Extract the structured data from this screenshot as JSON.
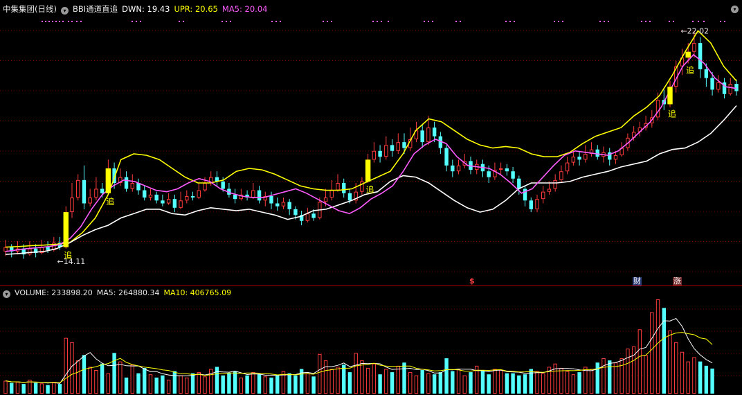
{
  "header": {
    "stock": "中集集团(日线)",
    "indicator": "BBI通道直追",
    "dwn_label": "DWN: 19.43",
    "upr_label": "UPR: 20.65",
    "ma5_label": "MA5: 20.04"
  },
  "volume_header": {
    "volume_label": "VOLUME: 233898.20",
    "ma5_label": "MA5: 264880.34",
    "ma10_label": "MA10: 406765.09"
  },
  "markers": {
    "low_label": "14.11",
    "high_label": "22.02",
    "zhui": "追",
    "event_s": "$",
    "event_cai": "财",
    "event_zhang": "涨"
  },
  "colors": {
    "up": "#ff3c3c",
    "down": "#54ffff",
    "upr_line": "#ffff00",
    "dwn_line": "#ffffff",
    "ma5_line": "#ff5cff",
    "zhui_bar": "#ffff00",
    "separator": "#b00000",
    "grid": "#7a0000"
  },
  "chart_data": {
    "type": "candlestick",
    "price_axis": {
      "low": 14.11,
      "high": 22.02
    },
    "candles_approx": [
      [
        14.45,
        14.6,
        14.85,
        14.3
      ],
      [
        14.6,
        14.45,
        14.7,
        14.25
      ],
      [
        14.45,
        14.55,
        14.8,
        14.35
      ],
      [
        14.55,
        14.35,
        14.7,
        14.2
      ],
      [
        14.35,
        14.55,
        14.8,
        14.3
      ],
      [
        14.55,
        14.4,
        14.7,
        14.25
      ],
      [
        14.4,
        14.6,
        14.85,
        14.35
      ],
      [
        14.6,
        14.5,
        14.8,
        14.4
      ],
      [
        14.5,
        14.75,
        14.95,
        14.45
      ],
      [
        14.75,
        14.6,
        14.95,
        14.5
      ],
      [
        14.6,
        15.8,
        16.0,
        14.55
      ],
      [
        15.8,
        16.3,
        16.8,
        15.6
      ],
      [
        16.3,
        16.9,
        17.1,
        16.2
      ],
      [
        16.9,
        16.1,
        17.4,
        15.9
      ],
      [
        16.1,
        16.3,
        16.6,
        16.0
      ],
      [
        16.3,
        16.6,
        17.0,
        16.2
      ],
      [
        16.6,
        16.45,
        16.8,
        16.3
      ],
      [
        16.45,
        17.3,
        17.6,
        16.4
      ],
      [
        17.3,
        16.8,
        17.5,
        16.6
      ],
      [
        16.8,
        17.0,
        17.3,
        16.7
      ],
      [
        17.0,
        16.6,
        17.2,
        16.5
      ],
      [
        16.6,
        16.8,
        17.1,
        16.5
      ],
      [
        16.8,
        16.55,
        16.95,
        16.4
      ],
      [
        16.55,
        16.3,
        16.7,
        16.2
      ],
      [
        16.3,
        16.4,
        16.6,
        16.2
      ],
      [
        16.4,
        16.2,
        16.5,
        16.1
      ],
      [
        16.2,
        16.1,
        16.4,
        16.0
      ],
      [
        16.1,
        16.25,
        16.45,
        16.05
      ],
      [
        16.25,
        15.95,
        16.4,
        15.8
      ],
      [
        15.95,
        16.2,
        16.5,
        15.9
      ],
      [
        16.2,
        16.35,
        16.55,
        16.1
      ],
      [
        16.35,
        16.3,
        16.5,
        16.2
      ],
      [
        16.3,
        16.55,
        16.8,
        16.25
      ],
      [
        16.55,
        16.8,
        17.0,
        16.5
      ],
      [
        16.8,
        17.0,
        17.2,
        16.7
      ],
      [
        17.0,
        16.85,
        17.2,
        16.7
      ],
      [
        16.85,
        16.6,
        17.0,
        16.5
      ],
      [
        16.6,
        16.4,
        16.8,
        16.3
      ],
      [
        16.4,
        16.25,
        16.6,
        16.1
      ],
      [
        16.25,
        16.4,
        16.6,
        16.2
      ],
      [
        16.4,
        16.3,
        16.55,
        16.2
      ],
      [
        16.3,
        16.55,
        16.8,
        16.25
      ],
      [
        16.55,
        16.2,
        16.7,
        16.1
      ],
      [
        16.2,
        16.35,
        16.5,
        16.0
      ],
      [
        16.35,
        16.1,
        16.5,
        15.9
      ],
      [
        16.1,
        16.0,
        16.3,
        15.85
      ],
      [
        16.0,
        16.15,
        16.3,
        15.9
      ],
      [
        16.15,
        15.9,
        16.25,
        15.7
      ],
      [
        15.9,
        15.7,
        16.0,
        15.55
      ],
      [
        15.7,
        15.5,
        15.85,
        15.35
      ],
      [
        15.5,
        15.75,
        15.95,
        15.45
      ],
      [
        15.75,
        15.6,
        15.9,
        15.5
      ],
      [
        15.6,
        16.15,
        16.3,
        15.55
      ],
      [
        16.15,
        16.3,
        16.6,
        16.0
      ],
      [
        16.3,
        16.55,
        16.9,
        16.2
      ],
      [
        16.55,
        16.8,
        17.1,
        16.5
      ],
      [
        16.8,
        16.45,
        16.95,
        16.3
      ],
      [
        16.45,
        16.2,
        16.6,
        16.1
      ],
      [
        16.2,
        16.5,
        16.8,
        16.1
      ],
      [
        16.5,
        16.85,
        17.0,
        16.4
      ],
      [
        16.85,
        17.6,
        17.8,
        16.8
      ],
      [
        17.6,
        17.9,
        18.2,
        17.5
      ],
      [
        17.9,
        17.7,
        18.1,
        17.5
      ],
      [
        17.7,
        18.1,
        18.4,
        17.6
      ],
      [
        18.1,
        17.9,
        18.3,
        17.7
      ],
      [
        17.9,
        18.2,
        18.5,
        17.8
      ],
      [
        18.2,
        18.0,
        18.5,
        17.8
      ],
      [
        18.0,
        18.3,
        18.7,
        17.9
      ],
      [
        18.3,
        18.6,
        18.9,
        18.2
      ],
      [
        18.6,
        18.2,
        18.8,
        18.0
      ],
      [
        18.2,
        18.7,
        19.1,
        18.1
      ],
      [
        18.7,
        18.4,
        18.9,
        18.2
      ],
      [
        18.4,
        18.0,
        18.55,
        17.8
      ],
      [
        18.0,
        17.4,
        18.1,
        17.2
      ],
      [
        17.4,
        17.2,
        17.6,
        17.0
      ],
      [
        17.2,
        17.4,
        17.6,
        17.1
      ],
      [
        17.4,
        17.55,
        17.8,
        17.3
      ],
      [
        17.55,
        17.25,
        17.7,
        17.1
      ],
      [
        17.25,
        17.45,
        17.6,
        17.1
      ],
      [
        17.45,
        17.2,
        17.6,
        17.0
      ],
      [
        17.2,
        17.0,
        17.4,
        16.8
      ],
      [
        17.0,
        17.25,
        17.5,
        16.9
      ],
      [
        17.25,
        17.3,
        17.5,
        17.1
      ],
      [
        17.3,
        17.2,
        17.45,
        17.05
      ],
      [
        17.2,
        16.95,
        17.35,
        16.8
      ],
      [
        16.95,
        16.6,
        17.05,
        16.4
      ],
      [
        16.6,
        16.2,
        16.7,
        16.0
      ],
      [
        16.2,
        15.9,
        16.3,
        15.8
      ],
      [
        15.9,
        16.25,
        16.4,
        15.8
      ],
      [
        16.25,
        16.5,
        16.7,
        16.1
      ],
      [
        16.5,
        16.6,
        16.85,
        16.4
      ],
      [
        16.6,
        16.9,
        17.1,
        16.5
      ],
      [
        16.9,
        17.2,
        17.4,
        16.8
      ],
      [
        17.2,
        17.5,
        17.7,
        17.1
      ],
      [
        17.5,
        17.7,
        17.9,
        17.4
      ],
      [
        17.7,
        17.6,
        17.9,
        17.4
      ],
      [
        17.6,
        17.8,
        18.1,
        17.5
      ],
      [
        17.8,
        17.95,
        18.2,
        17.7
      ],
      [
        17.95,
        17.7,
        18.1,
        17.6
      ],
      [
        17.7,
        17.85,
        18.05,
        17.5
      ],
      [
        17.85,
        17.6,
        18.0,
        17.4
      ],
      [
        17.6,
        17.75,
        17.9,
        17.45
      ],
      [
        17.75,
        18.0,
        18.2,
        17.7
      ],
      [
        18.0,
        18.35,
        18.5,
        17.9
      ],
      [
        18.35,
        18.55,
        18.75,
        18.25
      ],
      [
        18.55,
        18.7,
        18.9,
        18.4
      ],
      [
        18.7,
        18.85,
        19.1,
        18.6
      ],
      [
        18.85,
        19.05,
        19.3,
        18.7
      ],
      [
        19.05,
        19.65,
        19.9,
        18.95
      ],
      [
        19.65,
        19.5,
        20.0,
        19.3
      ],
      [
        19.5,
        20.1,
        20.3,
        19.4
      ],
      [
        20.1,
        20.8,
        21.0,
        19.9
      ],
      [
        20.8,
        21.1,
        21.4,
        20.5
      ],
      [
        21.1,
        21.3,
        21.6,
        20.9
      ],
      [
        21.3,
        21.6,
        22.02,
        21.1
      ],
      [
        21.6,
        20.7,
        21.8,
        20.4
      ],
      [
        20.7,
        20.4,
        20.9,
        20.1
      ],
      [
        20.4,
        20.0,
        20.6,
        19.8
      ],
      [
        20.0,
        20.25,
        20.5,
        19.9
      ],
      [
        20.25,
        19.85,
        20.4,
        19.7
      ],
      [
        19.85,
        20.2,
        20.4,
        19.8
      ],
      [
        20.2,
        19.95,
        20.35,
        19.8
      ]
    ],
    "upr_line_approx": [
      14.6,
      14.62,
      14.65,
      14.67,
      14.7,
      14.75,
      15.1,
      15.6,
      16.4,
      17.6,
      17.8,
      17.75,
      17.6,
      17.3,
      17.0,
      16.8,
      16.8,
      16.9,
      17.2,
      17.3,
      17.25,
      17.1,
      16.9,
      16.7,
      16.6,
      16.55,
      16.55,
      16.6,
      16.8,
      17.0,
      17.2,
      17.8,
      18.6,
      19.0,
      18.9,
      18.6,
      18.3,
      18.1,
      18.0,
      18.05,
      18.0,
      17.8,
      17.7,
      17.7,
      17.85,
      18.15,
      18.4,
      18.55,
      18.7,
      19.1,
      19.4,
      19.8,
      20.5,
      21.3,
      22.02,
      21.6,
      20.8,
      20.3
    ],
    "dwn_line_approx": [
      14.35,
      14.38,
      14.42,
      14.45,
      14.55,
      14.75,
      15.0,
      15.2,
      15.35,
      15.6,
      15.75,
      15.9,
      15.9,
      15.75,
      15.7,
      15.85,
      15.95,
      15.9,
      15.85,
      15.9,
      15.8,
      15.7,
      15.55,
      15.65,
      15.85,
      15.9,
      16.05,
      16.2,
      16.4,
      16.5,
      16.85,
      17.05,
      17.0,
      16.8,
      16.5,
      16.2,
      15.95,
      15.8,
      15.9,
      16.2,
      16.6,
      16.8,
      16.8,
      16.8,
      16.85,
      17.0,
      17.1,
      17.2,
      17.35,
      17.45,
      17.55,
      17.8,
      17.95,
      18.0,
      18.2,
      18.5,
      18.95,
      19.45
    ],
    "ma5_line_approx": [
      14.45,
      14.5,
      14.55,
      14.58,
      14.62,
      14.68,
      14.9,
      15.3,
      15.9,
      16.4,
      16.7,
      16.9,
      16.85,
      16.7,
      16.55,
      16.5,
      16.6,
      16.8,
      16.95,
      16.85,
      16.6,
      16.45,
      16.35,
      16.3,
      16.3,
      16.4,
      16.5,
      16.6,
      16.45,
      16.25,
      16.05,
      15.85,
      15.75,
      15.95,
      16.25,
      16.45,
      16.7,
      17.2,
      17.8,
      18.1,
      18.3,
      18.15,
      17.7,
      17.4,
      17.35,
      17.3,
      17.1,
      16.8,
      16.45,
      16.6,
      17.0,
      17.4,
      17.75,
      17.9,
      17.85,
      17.8,
      17.75,
      17.9,
      18.2,
      18.55,
      18.9,
      19.4,
      20.1,
      20.8,
      21.2,
      20.9,
      20.4,
      20.1,
      20.04
    ],
    "volume": {
      "values_approx": [
        120000,
        100000,
        110000,
        90000,
        130000,
        100000,
        95000,
        80000,
        110000,
        90000,
        520000,
        480000,
        310000,
        360000,
        250000,
        220000,
        280000,
        190000,
        380000,
        300000,
        150000,
        270000,
        190000,
        240000,
        180000,
        150000,
        170000,
        130000,
        210000,
        170000,
        150000,
        190000,
        200000,
        160000,
        230000,
        250000,
        170000,
        190000,
        210000,
        150000,
        170000,
        200000,
        180000,
        160000,
        150000,
        170000,
        210000,
        190000,
        170000,
        230000,
        190000,
        160000,
        370000,
        310000,
        230000,
        250000,
        270000,
        200000,
        380000,
        310000,
        240000,
        280000,
        180000,
        230000,
        200000,
        260000,
        290000,
        200000,
        170000,
        220000,
        190000,
        180000,
        200000,
        330000,
        210000,
        230000,
        170000,
        200000,
        260000,
        210000,
        180000,
        230000,
        220000,
        190000,
        190000,
        170000,
        180000,
        230000,
        210000,
        190000,
        250000,
        280000,
        240000,
        210000,
        180000,
        200000,
        250000,
        230000,
        290000,
        330000,
        310000,
        290000,
        330000,
        420000,
        440000,
        600000,
        360000,
        760000,
        880000,
        800000,
        590000,
        480000,
        390000,
        300000,
        340000,
        300000,
        260000,
        234000
      ]
    }
  }
}
